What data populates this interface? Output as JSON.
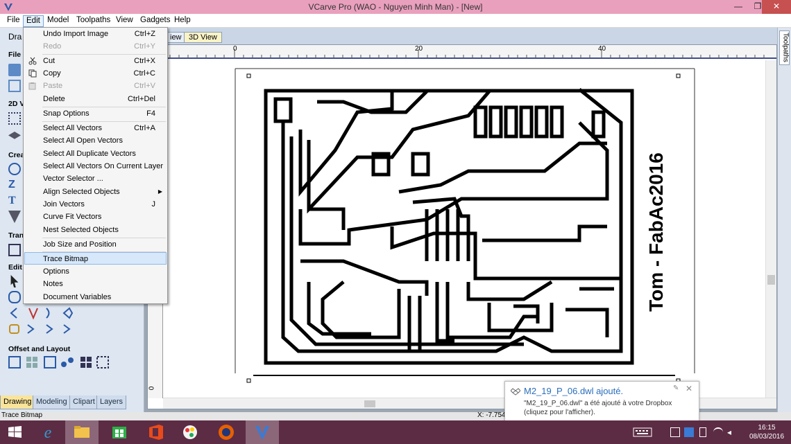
{
  "window": {
    "title": "VCarve Pro (WAO - Nguyen Minh Man) - [New]",
    "min_icon": "minimize-icon",
    "max_icon": "restore-icon",
    "close_icon": "close-icon",
    "min_glyph": "—",
    "max_glyph": "❐",
    "close_glyph": "✕"
  },
  "menubar": [
    "File",
    "Edit",
    "Model",
    "Toolpaths",
    "View",
    "Gadgets",
    "Help"
  ],
  "left_panel": {
    "title": "Dra",
    "sections": [
      "File",
      "2D V",
      "Crea",
      "Tran",
      "Edit",
      "Offset and Layout"
    ],
    "tabs": [
      "Drawing",
      "Modeling",
      "Clipart",
      "Layers"
    ],
    "active_tab": "Drawing"
  },
  "view_tabs": [
    {
      "label": "iew"
    },
    {
      "label": "3D View"
    }
  ],
  "right_tab": "Toolpaths",
  "ruler": {
    "h": [
      "0",
      "20",
      "40"
    ],
    "v": [
      "0"
    ]
  },
  "canvas_text": "Tom - FabAc2016",
  "edit_menu": {
    "items": [
      {
        "label": "Undo Import Image",
        "shortcut": "Ctrl+Z",
        "icon": "undo-icon",
        "disabled": false
      },
      {
        "label": "Redo",
        "shortcut": "Ctrl+Y",
        "icon": "",
        "disabled": true
      },
      {
        "sep": true
      },
      {
        "label": "Cut",
        "shortcut": "Ctrl+X",
        "icon": "scissors-icon",
        "disabled": false
      },
      {
        "label": "Copy",
        "shortcut": "Ctrl+C",
        "icon": "copy-icon",
        "disabled": false
      },
      {
        "label": "Paste",
        "shortcut": "Ctrl+V",
        "icon": "paste-icon",
        "disabled": true
      },
      {
        "label": "Delete",
        "shortcut": "Ctrl+Del",
        "icon": "",
        "disabled": false
      },
      {
        "sep": true
      },
      {
        "label": "Snap Options",
        "shortcut": "F4",
        "icon": "",
        "disabled": false
      },
      {
        "sep": true
      },
      {
        "label": "Select All Vectors",
        "shortcut": "Ctrl+A",
        "icon": "",
        "disabled": false
      },
      {
        "label": "Select All Open Vectors",
        "shortcut": "",
        "icon": "",
        "disabled": false
      },
      {
        "label": "Select All Duplicate Vectors",
        "shortcut": "",
        "icon": "",
        "disabled": false
      },
      {
        "label": "Select All Vectors On Current Layer",
        "shortcut": "",
        "icon": "",
        "disabled": false
      },
      {
        "label": "Vector Selector ...",
        "shortcut": "",
        "icon": "",
        "disabled": false
      },
      {
        "label": "Align Selected Objects",
        "shortcut": "",
        "icon": "",
        "disabled": false,
        "submenu": true
      },
      {
        "label": "Join Vectors",
        "shortcut": "J",
        "icon": "",
        "disabled": false
      },
      {
        "label": "Curve Fit Vectors",
        "shortcut": "",
        "icon": "",
        "disabled": false
      },
      {
        "label": "Nest Selected Objects",
        "shortcut": "",
        "icon": "",
        "disabled": false
      },
      {
        "sep": true
      },
      {
        "label": "Job Size and Position",
        "shortcut": "",
        "icon": "",
        "disabled": false
      },
      {
        "sep": true
      },
      {
        "label": "Trace Bitmap",
        "shortcut": "",
        "icon": "",
        "disabled": false,
        "highlighted": true
      },
      {
        "label": "Options",
        "shortcut": "",
        "icon": "",
        "disabled": false
      },
      {
        "label": "Notes",
        "shortcut": "",
        "icon": "",
        "disabled": false
      },
      {
        "label": "Document Variables",
        "shortcut": "",
        "icon": "",
        "disabled": false
      }
    ]
  },
  "status": {
    "text": "Trace Bitmap",
    "coords": "X: -7.754"
  },
  "toast": {
    "title": "M2_19_P_06.dwl ajouté.",
    "body": "\"M2_19_P_06.dwl\" a été ajouté à votre Dropbox (cliquez pour l'afficher).",
    "icon": "dropbox-icon",
    "pin_icon": "pin-icon",
    "close_icon": "close-icon",
    "pin_glyph": "✎",
    "close_glyph": "✕"
  },
  "taskbar": {
    "apps": [
      "windows-start-icon",
      "internet-explorer-icon",
      "file-explorer-icon",
      "store-icon",
      "office-icon",
      "paint-icon",
      "firefox-icon",
      "vcarve-icon"
    ],
    "active_app": "vcarve-icon",
    "clock_time": "16:15",
    "clock_date": "08/03/2016"
  },
  "colors": {
    "titlebar": "#e9a0bd",
    "taskbar": "#5c2c44",
    "menu_highlight": "#d7e8fb",
    "toast_title": "#2a6ebd"
  }
}
